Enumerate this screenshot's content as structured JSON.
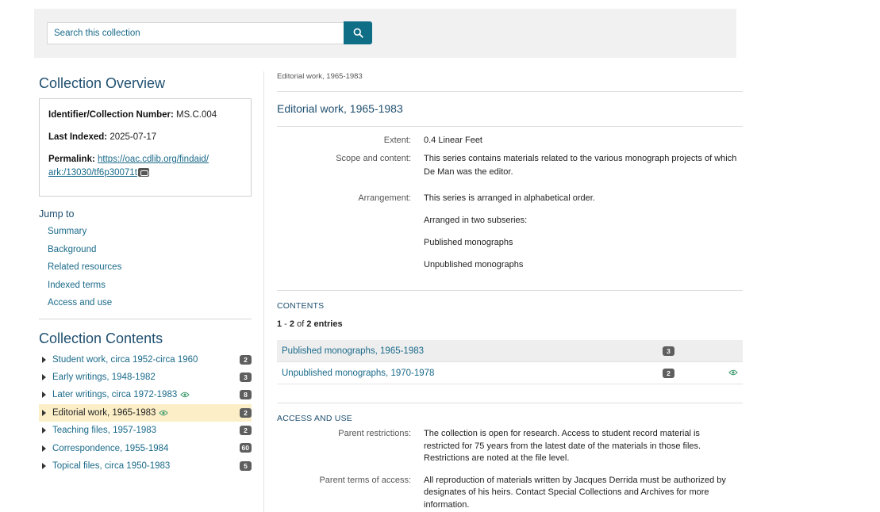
{
  "search": {
    "placeholder": "Search this collection",
    "button_icon": "search-icon"
  },
  "overview": {
    "title": "Collection Overview",
    "identifier_label": "Identifier/Collection Number:",
    "identifier_value": "MS.C.004",
    "indexed_label": "Last Indexed:",
    "indexed_value": "2025-07-17",
    "permalink_label": "Permalink:",
    "permalink_line1": "https://oac.cdlib.org/findaid/",
    "permalink_line2": "ark:/13030/tf6p30071t"
  },
  "jump": {
    "title": "Jump to",
    "items": [
      "Summary",
      "Background",
      "Related resources",
      "Indexed terms",
      "Access and use"
    ]
  },
  "contents": {
    "title": "Collection Contents",
    "items": [
      {
        "label": "Student work, circa 1952-circa 1960",
        "count": "2",
        "viewable": false,
        "active": false
      },
      {
        "label": "Early writings, 1948-1982",
        "count": "3",
        "viewable": false,
        "active": false
      },
      {
        "label": "Later writings, circa 1972-1983",
        "count": "8",
        "viewable": true,
        "active": false
      },
      {
        "label": "Editorial work, 1965-1983",
        "count": "2",
        "viewable": true,
        "active": true
      },
      {
        "label": "Teaching files, 1957-1983",
        "count": "2",
        "viewable": false,
        "active": false
      },
      {
        "label": "Correspondence, 1955-1984",
        "count": "60",
        "viewable": false,
        "active": false
      },
      {
        "label": "Topical files, circa 1950-1983",
        "count": "5",
        "viewable": false,
        "active": false
      }
    ]
  },
  "main": {
    "breadcrumb": "Editorial work, 1965-1983",
    "title": "Editorial work, 1965-1983",
    "extent_label": "Extent:",
    "extent_value": "0.4 Linear Feet",
    "scope_label": "Scope and content:",
    "scope_value": "This series contains materials related to the various monograph projects of which De Man was the editor.",
    "arrangement_label": "Arrangement:",
    "arrangement_values": [
      "This series is arranged in alphabetical order.",
      "Arranged in two subseries:",
      "Published monographs",
      "Unpublished monographs"
    ]
  },
  "contents_table": {
    "heading": "CONTENTS",
    "range_start": "1",
    "range_sep": " - ",
    "range_end": "2",
    "of": " of ",
    "total": "2 entries",
    "rows": [
      {
        "title": "Published monographs, 1965-1983",
        "count": "3",
        "viewable": false
      },
      {
        "title": "Unpublished monographs, 1970-1978",
        "count": "2",
        "viewable": true
      }
    ]
  },
  "access": {
    "heading": "ACCESS AND USE",
    "restrictions_label": "Parent restrictions:",
    "restrictions_value": "The collection is open for research. Access to student record material is restricted for 75 years from the latest date of the materials in those files. Restrictions are noted at the file level.",
    "terms_label": "Parent terms of access:",
    "terms_value": "All reproduction of materials written by Jacques Derrida must be authorized by designates of his heirs. Contact Special Collections and Archives for more information."
  },
  "colors": {
    "accent": "#0e6e86",
    "link": "#1a6a8a",
    "heading": "#1f4f6f",
    "highlight": "#fcefc8"
  }
}
